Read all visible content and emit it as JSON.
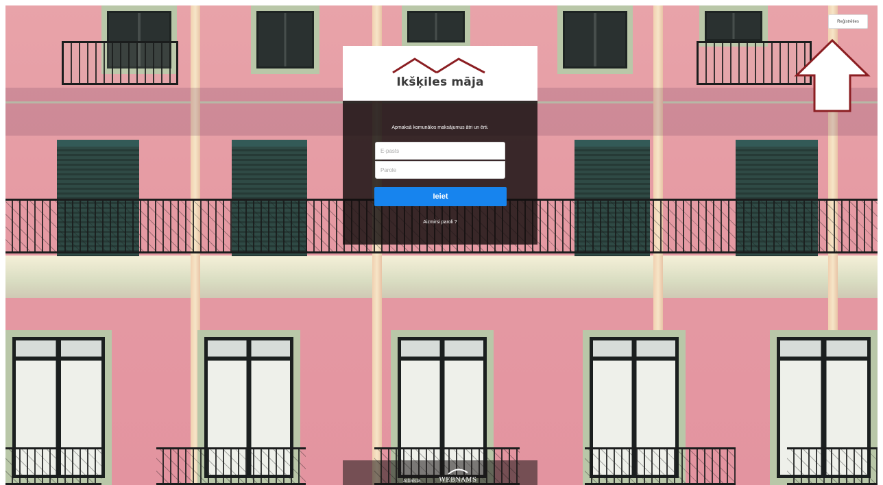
{
  "brand": {
    "logo_text": "Ikšķiles māja",
    "roof_color": "#8b1e22"
  },
  "header": {
    "register_label": "Reģistrēties"
  },
  "login": {
    "tagline": "Apmaksā komunālos maksājumus ātri un ērti.",
    "email_placeholder": "E-pasts",
    "password_placeholder": "Parole",
    "submit_label": "Ieiet",
    "forgot_password_label": "Aizmirsi paroli ?"
  },
  "footer": {
    "supported_by_label": "Atbalsta",
    "partner_logo_text": "WEBNAMS"
  },
  "annotation": {
    "icon": "up-arrow-icon",
    "color": "#8b1e22"
  },
  "colors": {
    "accent": "#1784ee",
    "panel_dark": "#120e0e"
  }
}
